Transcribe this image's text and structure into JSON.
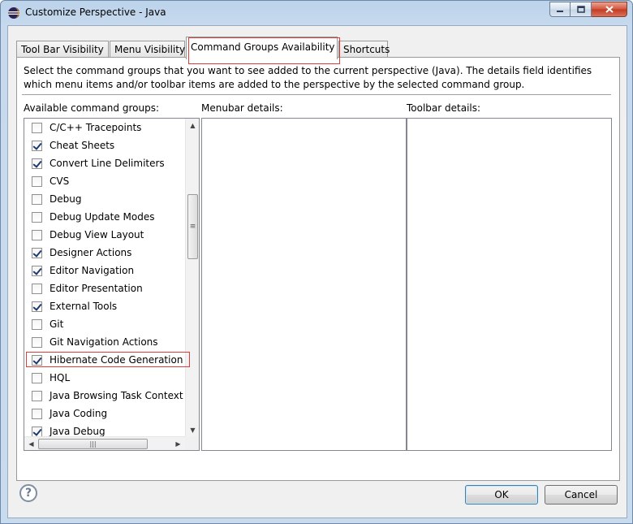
{
  "window": {
    "title": "Customize Perspective - Java"
  },
  "tabs": [
    {
      "label": "Tool Bar Visibility"
    },
    {
      "label": "Menu Visibility"
    },
    {
      "label": "Command Groups Availability"
    },
    {
      "label": "Shortcuts"
    }
  ],
  "active_tab": "Command Groups Availability",
  "description": "Select the command groups that you want to see added to the current perspective (Java).  The details field identifies which menu items and/or toolbar items are added to the perspective by the selected command group.",
  "labels": {
    "available": "Available command groups:",
    "menubar": "Menubar details:",
    "toolbar": "Toolbar details:"
  },
  "command_groups": [
    {
      "label": "C/C++ Tracepoints",
      "checked": false
    },
    {
      "label": "Cheat Sheets",
      "checked": true
    },
    {
      "label": "Convert Line Delimiters",
      "checked": true
    },
    {
      "label": "CVS",
      "checked": false
    },
    {
      "label": "Debug",
      "checked": false
    },
    {
      "label": "Debug Update Modes",
      "checked": false
    },
    {
      "label": "Debug View Layout",
      "checked": false
    },
    {
      "label": "Designer Actions",
      "checked": true
    },
    {
      "label": "Editor Navigation",
      "checked": true
    },
    {
      "label": "Editor Presentation",
      "checked": false
    },
    {
      "label": "External Tools",
      "checked": true
    },
    {
      "label": "Git",
      "checked": false
    },
    {
      "label": "Git Navigation Actions",
      "checked": false
    },
    {
      "label": "Hibernate Code Generation",
      "checked": true,
      "highlighted": true
    },
    {
      "label": "HQL",
      "checked": false
    },
    {
      "label": "Java Browsing Task Context",
      "checked": false
    },
    {
      "label": "Java Coding",
      "checked": false
    },
    {
      "label": "Java Debug",
      "checked": true
    }
  ],
  "buttons": {
    "ok": "OK",
    "cancel": "Cancel"
  },
  "icons": {
    "app": "eclipse-icon",
    "help": "help-icon"
  },
  "colors": {
    "highlight_box": "#e03c3c",
    "default_button_border": "#3c7fb1"
  }
}
